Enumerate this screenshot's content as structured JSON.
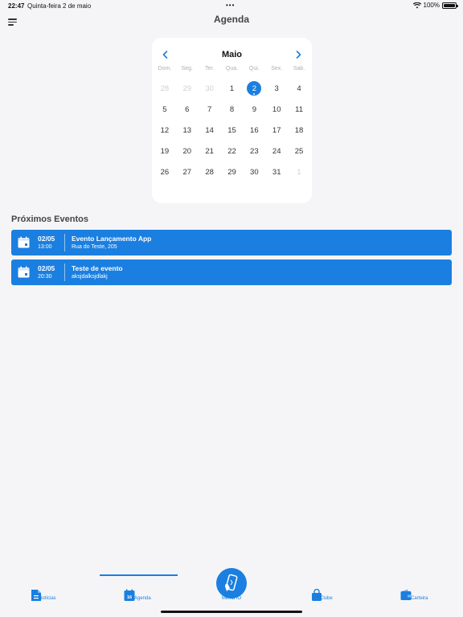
{
  "status_bar": {
    "time": "22:47",
    "date": "Quinta-feira 2 de maio",
    "dots": "•••",
    "battery": "100%"
  },
  "header": {
    "title": "Agenda",
    "menu_icon": "hamburger-menu-icon"
  },
  "calendar": {
    "month": "Maio",
    "weekdays": [
      "Dom.",
      "Seg.",
      "Ter.",
      "Qua.",
      "Qui.",
      "Sex.",
      "Sab."
    ],
    "days": [
      {
        "n": "28",
        "muted": true
      },
      {
        "n": "29",
        "muted": true
      },
      {
        "n": "30",
        "muted": true
      },
      {
        "n": "1"
      },
      {
        "n": "2",
        "selected": true,
        "has_event": true
      },
      {
        "n": "3"
      },
      {
        "n": "4"
      },
      {
        "n": "5"
      },
      {
        "n": "6"
      },
      {
        "n": "7"
      },
      {
        "n": "8"
      },
      {
        "n": "9"
      },
      {
        "n": "10"
      },
      {
        "n": "11"
      },
      {
        "n": "12"
      },
      {
        "n": "13"
      },
      {
        "n": "14"
      },
      {
        "n": "15"
      },
      {
        "n": "16"
      },
      {
        "n": "17"
      },
      {
        "n": "18"
      },
      {
        "n": "19"
      },
      {
        "n": "20"
      },
      {
        "n": "21"
      },
      {
        "n": "22"
      },
      {
        "n": "23"
      },
      {
        "n": "24"
      },
      {
        "n": "25"
      },
      {
        "n": "26"
      },
      {
        "n": "27"
      },
      {
        "n": "28"
      },
      {
        "n": "29"
      },
      {
        "n": "30"
      },
      {
        "n": "31"
      },
      {
        "n": "1",
        "muted": true
      }
    ]
  },
  "events": {
    "title": "Próximos Eventos",
    "items": [
      {
        "date": "02/05",
        "time": "13:00",
        "name": "Evento Lançamento App",
        "location": "Rua do Teste, 205"
      },
      {
        "date": "02/05",
        "time": "20:30",
        "name": "Teste de evento",
        "location": "aksjdalksjdlakj"
      }
    ]
  },
  "tabbar": {
    "tabs": [
      {
        "label": "Notícias",
        "icon": "news-document-icon"
      },
      {
        "label": "Agenda",
        "icon": "calendar-icon",
        "badge": "16",
        "active": true
      },
      {
        "label": "Minha IO",
        "icon": "phone-hand-icon"
      },
      {
        "label": "Clube",
        "icon": "shopping-bag-icon"
      },
      {
        "label": "Carteira",
        "icon": "wallet-icon"
      }
    ]
  },
  "colors": {
    "accent": "#1a7fe0",
    "background": "#f5f5f7"
  }
}
